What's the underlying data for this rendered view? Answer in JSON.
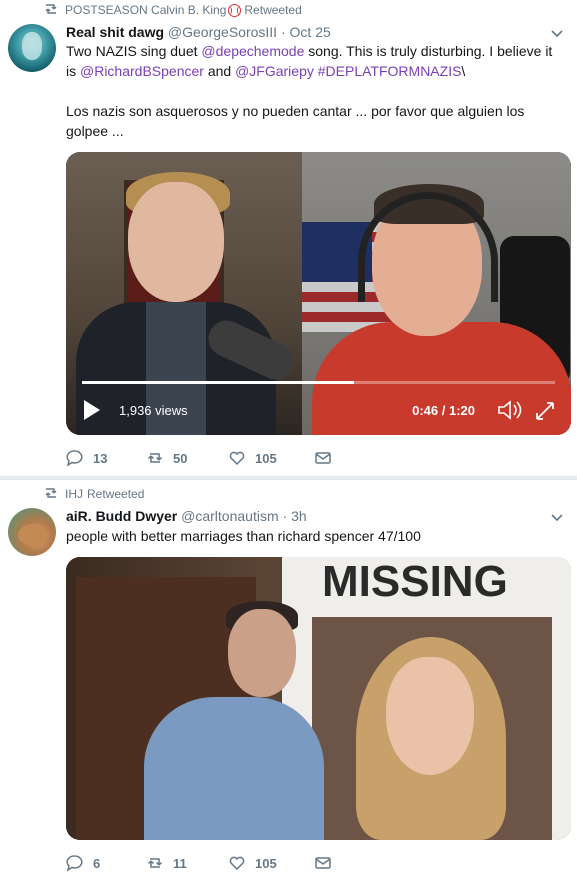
{
  "tweet1": {
    "retweeter": "POSTSEASON Calvin B. King",
    "retweeted_label": "Retweeted",
    "name": "Real shit dawg",
    "handle": "@GeorgeSorosIII",
    "separator": "·",
    "time": "Oct 25",
    "text_p1": {
      "t1": "Two NAZIS sing duet ",
      "m1": "@depechemode",
      "t2": " song. This is truly disturbing. I believe it is ",
      "m2": "@RichardBSpencer",
      "t3": " and ",
      "m3": "@JFGariepy",
      "t4": " ",
      "h1": "#DEPLATFORMNAZIS",
      "t5": "\\"
    },
    "text_p2": "Los nazis son asquerosos y no pueden cantar ... por favor que alguien los golpee ...",
    "video": {
      "views": "1,936 views",
      "time": "0:46 / 1:20",
      "progress": 0.575
    },
    "actions": {
      "replies": "13",
      "retweets": "50",
      "likes": "105"
    }
  },
  "tweet2": {
    "retweeter": "IHJ",
    "retweeted_label": "Retweeted",
    "name": "aiR. Budd Dwyer",
    "handle": "@carltonautism",
    "separator": "·",
    "time": "3h",
    "text": "people with better marriages than richard spencer 47/100",
    "poster_text": "MISSING",
    "actions": {
      "replies": "6",
      "retweets": "11",
      "likes": "105"
    }
  },
  "colors": {
    "link": "#1b95e0",
    "mention": "#7b3fb6",
    "muted": "#657786"
  },
  "icons": [
    "retweet-icon",
    "chevron-down-icon",
    "reply-icon",
    "heart-icon",
    "dm-icon",
    "play-icon",
    "volume-icon",
    "fullscreen-icon"
  ]
}
